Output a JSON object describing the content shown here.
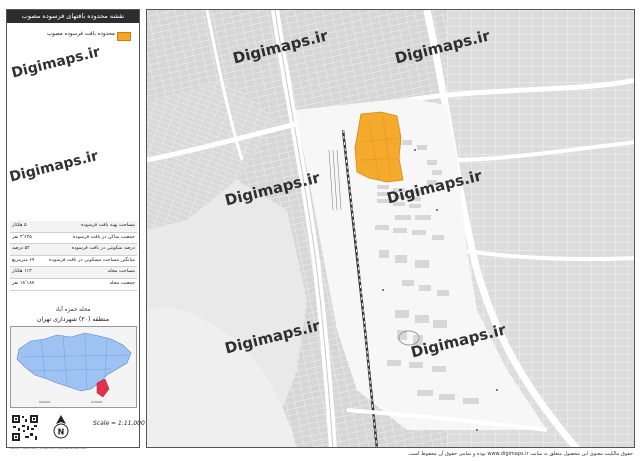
{
  "legend": {
    "title": "نقشه محدوده بافتهای فرسوده مصوب",
    "swatch_label": "محدوده بافت فرسوده مصوب",
    "swatch_color": "#f5a623",
    "rows": [
      {
        "label": "مساحت پهنه بافت فرسوده",
        "value": "۵ هکتار"
      },
      {
        "label": "جمعیت ساکن در بافت فرسوده",
        "value": "۳٬۶۴۵ نفر"
      },
      {
        "label": "درصد سکونتی در بافت فرسوده",
        "value": "۵۲ درصد"
      },
      {
        "label": "میانگین مساحت مسکونی در بافت فرسوده",
        "value": "۶۷ مترمربع"
      },
      {
        "label": "مساحت محله",
        "value": "۱۱۳ هکتار"
      },
      {
        "label": "جمعیت محله",
        "value": "۱۸٬۱۸۷ نفر"
      }
    ],
    "district": "محله حمزه آباد",
    "region": "منطقه (۲۰) شهرداری تهران",
    "scale": "Scale = 1:11,000",
    "north_letter": "N",
    "credit": "Datum: WGS1984 | Projection: Transverse Mercator"
  },
  "watermark_text": "Digimaps.ir",
  "footer": "حقوق مالکیت معنوی این محصول متعلق به سایت www.digimaps.ir بوده و تمامی حقوق آن محفوظ است.",
  "colors": {
    "map_background": "#e6e6e6",
    "highlight": "#f5a623",
    "inset_city": "#9ec3f2",
    "inset_district": "#e0324a"
  }
}
